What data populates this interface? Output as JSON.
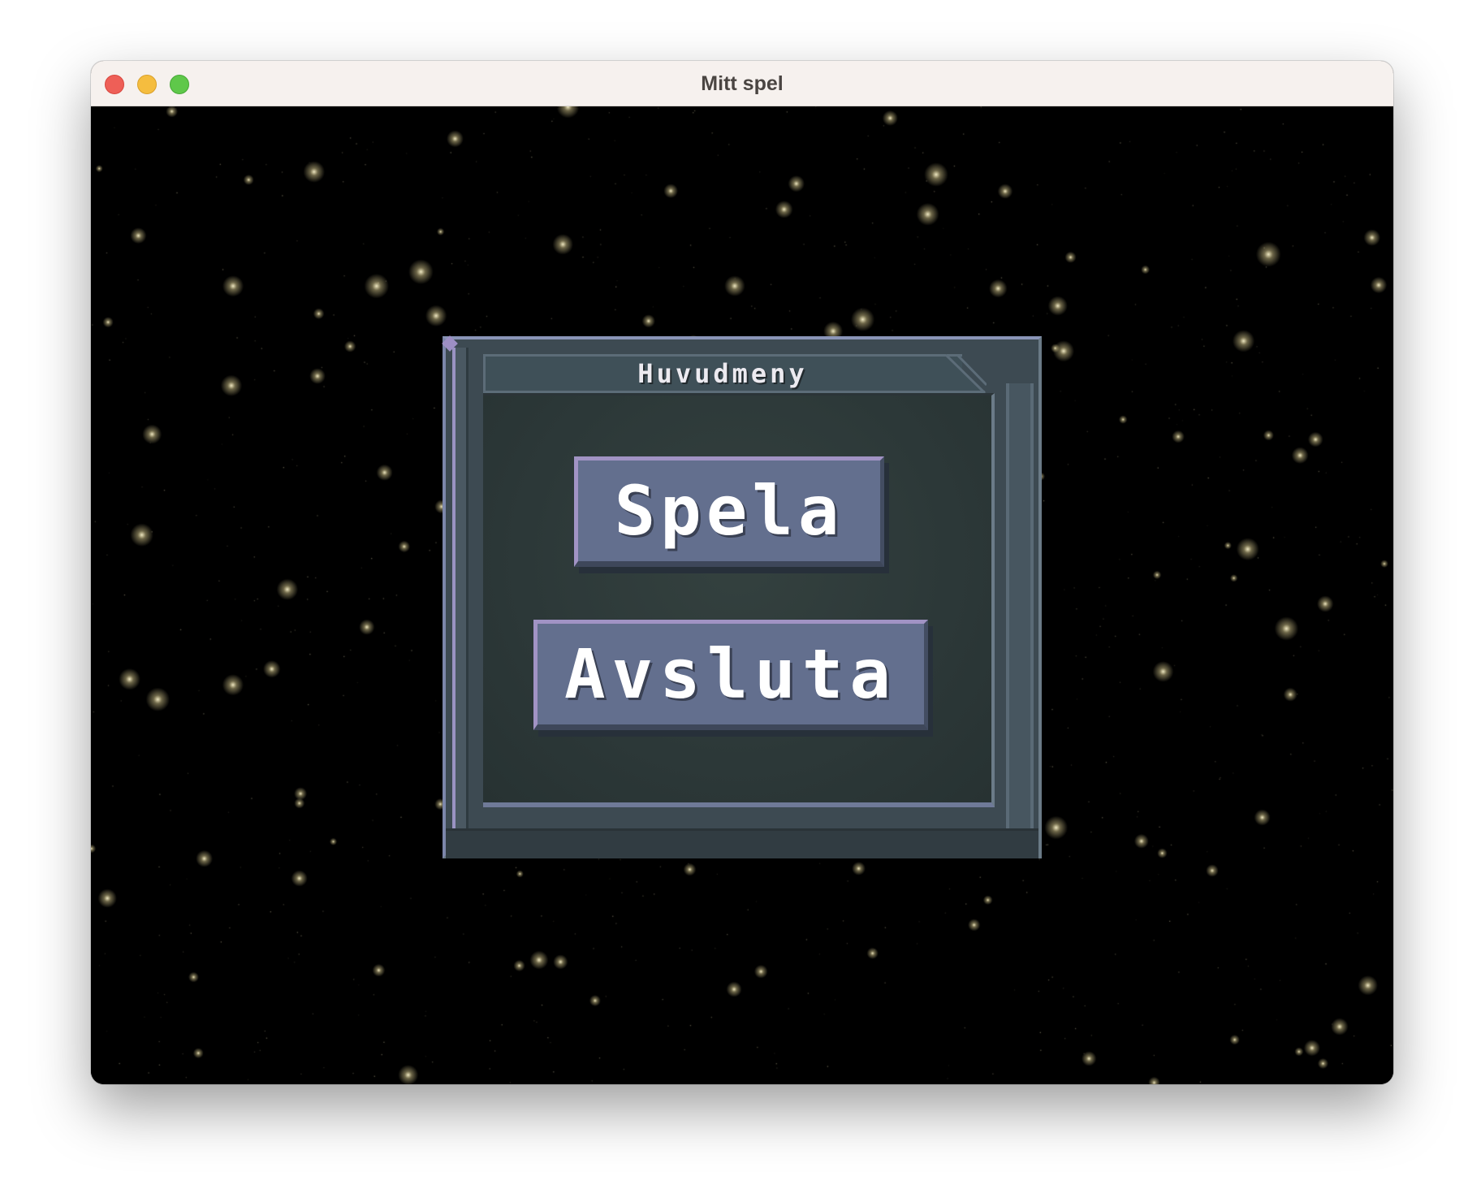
{
  "window": {
    "title": "Mitt spel"
  },
  "menu": {
    "title": "Huvudmeny",
    "buttons": {
      "play_label": "Spela",
      "quit_label": "Avsluta"
    }
  },
  "colors": {
    "panel": "#3d4a52",
    "panel_inner": "#2c3838",
    "button_face": "#636f8e",
    "button_highlight": "#a193c4",
    "star": "#f3e8b0",
    "space": "#000000"
  }
}
